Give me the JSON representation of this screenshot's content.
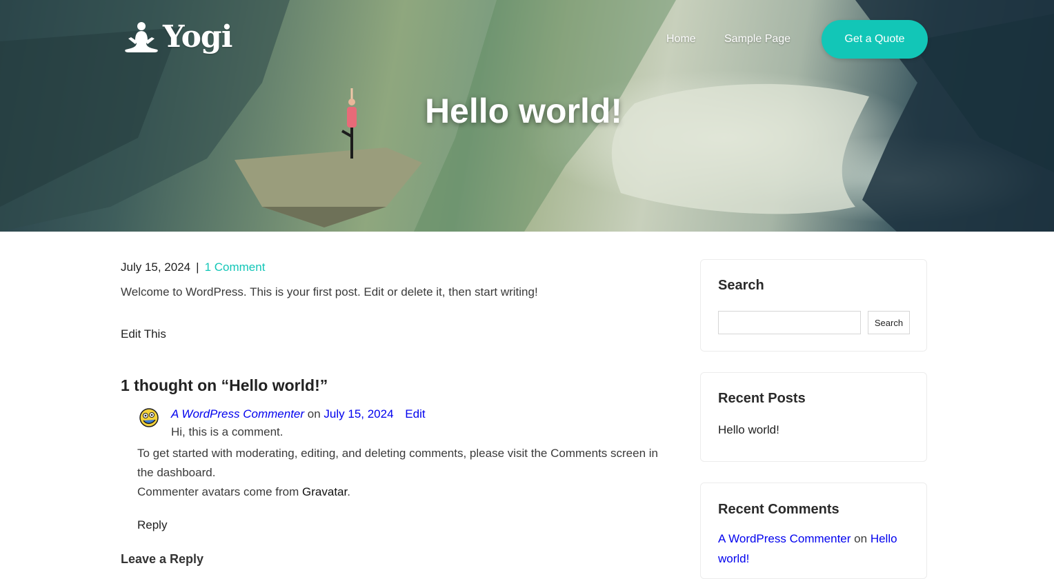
{
  "site": {
    "logo_text": "Yogi"
  },
  "nav": {
    "items": [
      {
        "label": "Home"
      },
      {
        "label": "Sample Page"
      }
    ],
    "cta_label": "Get a Quote"
  },
  "hero": {
    "title": "Hello world!"
  },
  "post": {
    "date": "July 15, 2024",
    "separator": "|",
    "comments_link": "1 Comment",
    "intro": "Welcome to WordPress. This is your first post. Edit or delete it, then start writing!",
    "edit_link": "Edit This"
  },
  "comments": {
    "heading": "1 thought on “Hello world!”",
    "items": [
      {
        "author": "A WordPress Commenter",
        "on_word": "on",
        "date": "July 15, 2024",
        "edit_label": "Edit",
        "line1": "Hi, this is a comment.",
        "line2": "To get started with moderating, editing, and deleting comments, please visit the Comments screen in the dashboard.",
        "line3_prefix": "Commenter avatars come from",
        "line3_link": "Gravatar",
        "line3_suffix": ".",
        "reply_label": "Reply"
      }
    ],
    "leave_reply_heading": "Leave a Reply"
  },
  "sidebar": {
    "search": {
      "title": "Search",
      "button_label": "Search",
      "input_value": "",
      "placeholder": ""
    },
    "recent_posts": {
      "title": "Recent Posts",
      "items": [
        {
          "label": "Hello world!"
        }
      ]
    },
    "recent_comments": {
      "title": "Recent Comments",
      "items": [
        {
          "author": "A WordPress Commenter",
          "on_word": "on",
          "post": "Hello world!"
        }
      ]
    }
  },
  "colors": {
    "accent": "#12c6b7",
    "text": "#1f1f1f",
    "muted": "#3a3a3a"
  }
}
